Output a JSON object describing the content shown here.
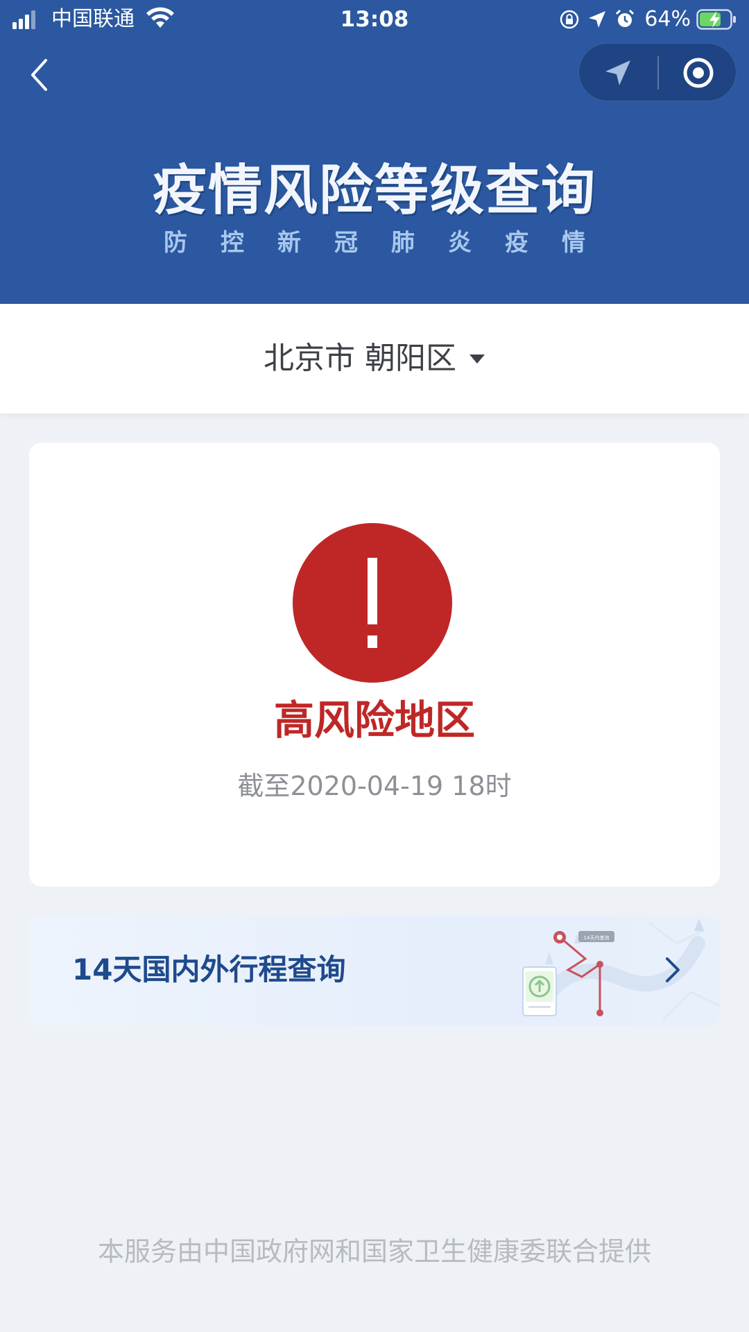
{
  "status_bar": {
    "carrier": "中国联通",
    "time": "13:08",
    "battery": "64%"
  },
  "header": {
    "title": "疫情风险等级查询",
    "subtitle_chars": [
      "防",
      "控",
      "新",
      "冠",
      "肺",
      "炎",
      "疫",
      "情"
    ]
  },
  "location": {
    "label": "北京市 朝阳区"
  },
  "risk": {
    "level": "高风险地区",
    "updated": "截至2020-04-19 18时",
    "color": "#bf2727"
  },
  "trip": {
    "label": "14天国内外行程查询",
    "illustration_tag": "14天内查询"
  },
  "footer": {
    "text": "本服务由中国政府网和国家卫生健康委联合提供"
  },
  "colors": {
    "header_blue": "#2b58a0",
    "page_bg": "#eef1f5",
    "trip_text": "#1f4a8c"
  }
}
